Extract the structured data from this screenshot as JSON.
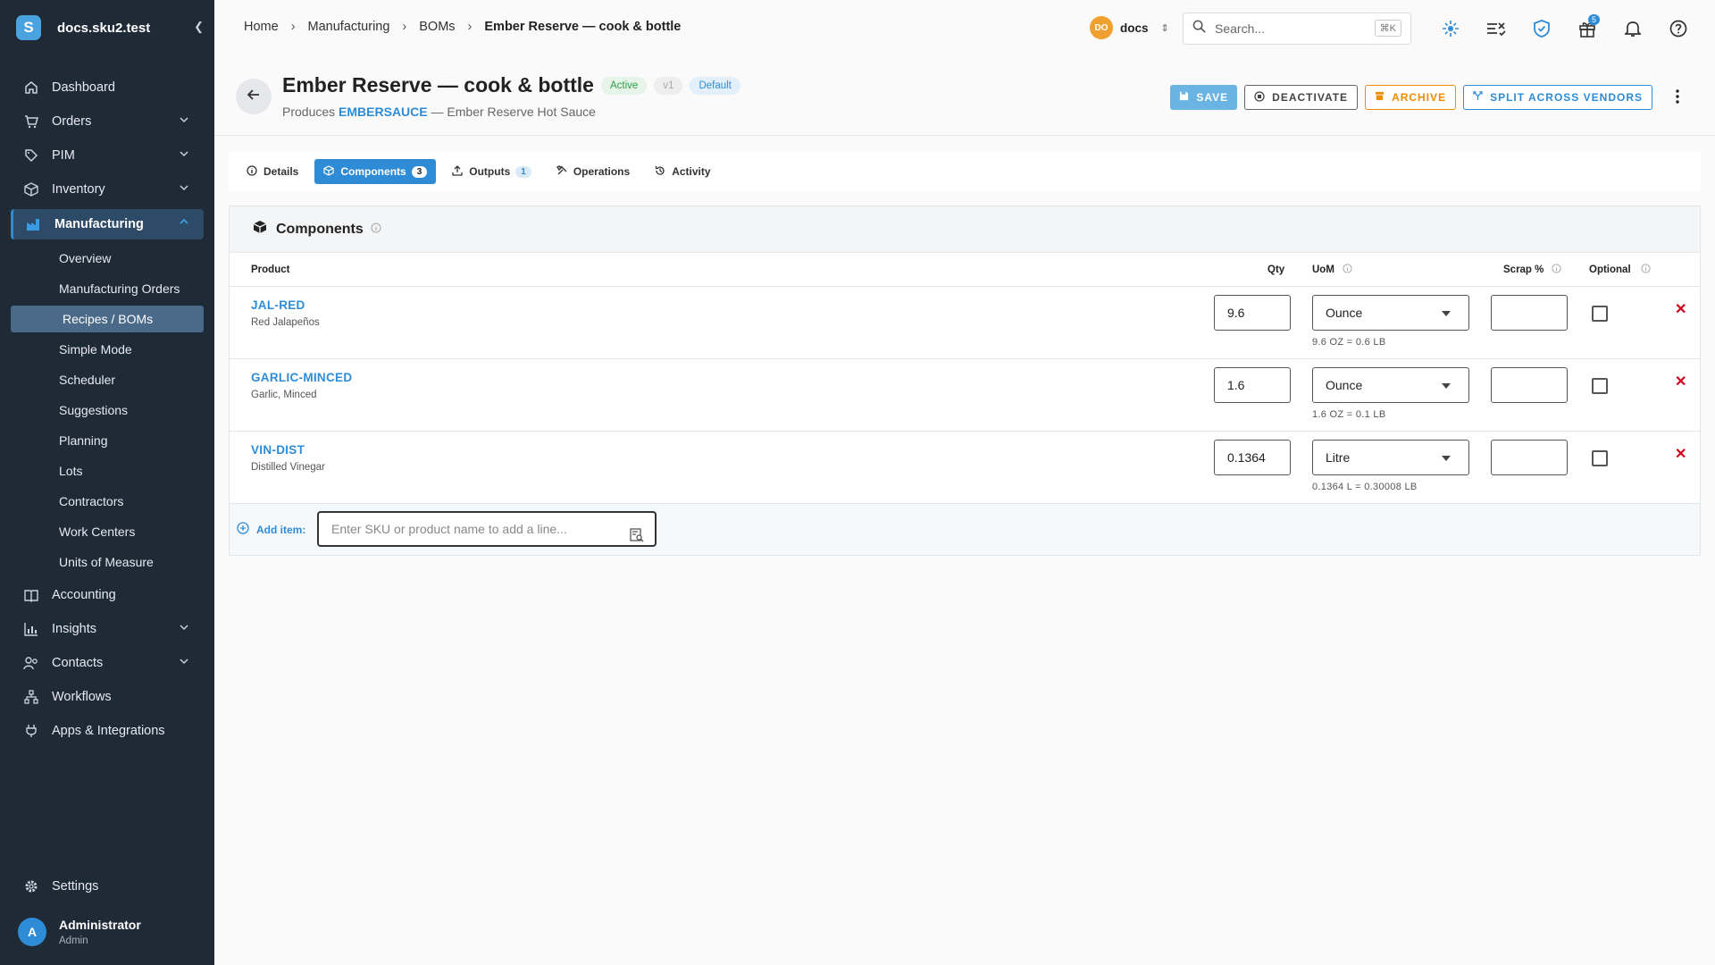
{
  "sidebar": {
    "brand": "docs.sku2.test",
    "items": [
      {
        "label": "Dashboard",
        "icon": "home-icon",
        "expandable": false
      },
      {
        "label": "Orders",
        "icon": "cart-icon",
        "expandable": true
      },
      {
        "label": "PIM",
        "icon": "tag-icon",
        "expandable": true
      },
      {
        "label": "Inventory",
        "icon": "box-icon",
        "expandable": true
      },
      {
        "label": "Manufacturing",
        "icon": "factory-icon",
        "expandable": true,
        "active": true
      }
    ],
    "manufacturing_sub": [
      "Overview",
      "Manufacturing Orders",
      "Recipes / BOMs",
      "Simple Mode",
      "Scheduler",
      "Suggestions",
      "Planning",
      "Lots",
      "Contractors",
      "Work Centers",
      "Units of Measure"
    ],
    "active_sub": "Recipes / BOMs",
    "items_after": [
      {
        "label": "Accounting",
        "icon": "book-icon",
        "expandable": false
      },
      {
        "label": "Insights",
        "icon": "chart-icon",
        "expandable": true
      },
      {
        "label": "Contacts",
        "icon": "people-icon",
        "expandable": true
      },
      {
        "label": "Workflows",
        "icon": "workflow-icon",
        "expandable": false
      },
      {
        "label": "Apps & Integrations",
        "icon": "plug-icon",
        "expandable": false
      }
    ],
    "settings": "Settings",
    "user": {
      "initial": "A",
      "name": "Administrator",
      "role": "Admin"
    }
  },
  "topbar": {
    "breadcrumbs": [
      "Home",
      "Manufacturing",
      "BOMs",
      "Ember Reserve — cook & bottle"
    ],
    "org_initials": "DO",
    "org_name": "docs",
    "search_placeholder": "Search...",
    "search_shortcut": "⌘K",
    "gift_count": "5"
  },
  "header": {
    "title": "Ember Reserve — cook & bottle",
    "status": "Active",
    "version": "v1",
    "default_badge": "Default",
    "produces_label": "Produces",
    "produces_sku": "EMBERSAUCE",
    "produces_name": "— Ember Reserve Hot Sauce",
    "actions": {
      "save": "Save",
      "deactivate": "Deactivate",
      "archive": "Archive",
      "split": "Split across vendors"
    }
  },
  "tabs": [
    {
      "label": "Details",
      "icon": "info-icon"
    },
    {
      "label": "Components",
      "icon": "cube-icon",
      "count": "3",
      "active": true
    },
    {
      "label": "Outputs",
      "icon": "upload-icon",
      "count": "1"
    },
    {
      "label": "Operations",
      "icon": "tools-icon"
    },
    {
      "label": "Activity",
      "icon": "history-icon"
    }
  ],
  "components": {
    "title": "Components",
    "columns": {
      "product": "Product",
      "qty": "Qty",
      "uom": "UoM",
      "scrap": "Scrap %",
      "optional": "Optional"
    },
    "rows": [
      {
        "sku": "JAL-RED",
        "name": "Red Jalapeños",
        "qty": "9.6",
        "uom": "Ounce",
        "conversion": "9.6 OZ = 0.6 LB",
        "scrap": "",
        "optional": false
      },
      {
        "sku": "GARLIC-MINCED",
        "name": "Garlic, Minced",
        "qty": "1.6",
        "uom": "Ounce",
        "conversion": "1.6 OZ = 0.1 LB",
        "scrap": "",
        "optional": false
      },
      {
        "sku": "VIN-DIST",
        "name": "Distilled Vinegar",
        "qty": "0.1364",
        "uom": "Litre",
        "conversion": "0.1364 L = 0.30008 LB",
        "scrap": "",
        "optional": false
      }
    ],
    "add_item_label": "Add item:",
    "add_item_placeholder": "Enter SKU or product name to add a line..."
  }
}
